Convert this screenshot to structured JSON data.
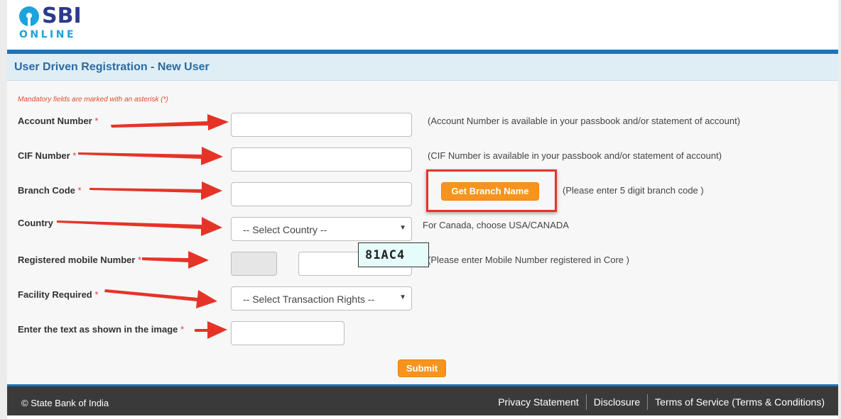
{
  "brand": {
    "line1": "SBI",
    "line2": "ONLINE"
  },
  "page_title": "User Driven Registration - New User",
  "mandatory_note": "Mandatory fields are marked with an asterisk (*)",
  "fields": {
    "account_number": {
      "label": "Account Number",
      "asterisk": "*",
      "value": "",
      "hint": "(Account Number is available in your passbook and/or statement of account)"
    },
    "cif_number": {
      "label": "CIF Number",
      "asterisk": "*",
      "value": "",
      "hint": "(CIF Number is available in your passbook and/or statement of account)"
    },
    "branch_code": {
      "label": "Branch Code",
      "asterisk": "*",
      "value": "",
      "button": "Get Branch Name",
      "hint": "(Please enter 5 digit branch code )"
    },
    "country": {
      "label": "Country",
      "selected": "-- Select Country --",
      "hint": "For Canada, choose USA/CANADA"
    },
    "mobile": {
      "label": "Registered mobile Number",
      "asterisk": "*",
      "code_value": "",
      "value": "",
      "hint": "(Please enter Mobile Number registered in Core )"
    },
    "facility": {
      "label": "Facility Required",
      "asterisk": "*",
      "selected": "-- Select Transaction Rights --"
    },
    "captcha": {
      "label": "Enter the text as shown in the image",
      "asterisk": "*",
      "value": "",
      "image_text": "81AC4"
    }
  },
  "submit_label": "Submit",
  "footer": {
    "copyright": "© State Bank of India",
    "links": [
      "Privacy Statement",
      "Disclosure",
      "Terms of Service (Terms & Conditions)"
    ]
  },
  "colors": {
    "brand_blue": "#1d73b7",
    "title_text": "#2c6aa0",
    "accent_orange": "#f7941d",
    "annotation_red": "#e53427",
    "footer_bg": "#3a3a3a"
  }
}
